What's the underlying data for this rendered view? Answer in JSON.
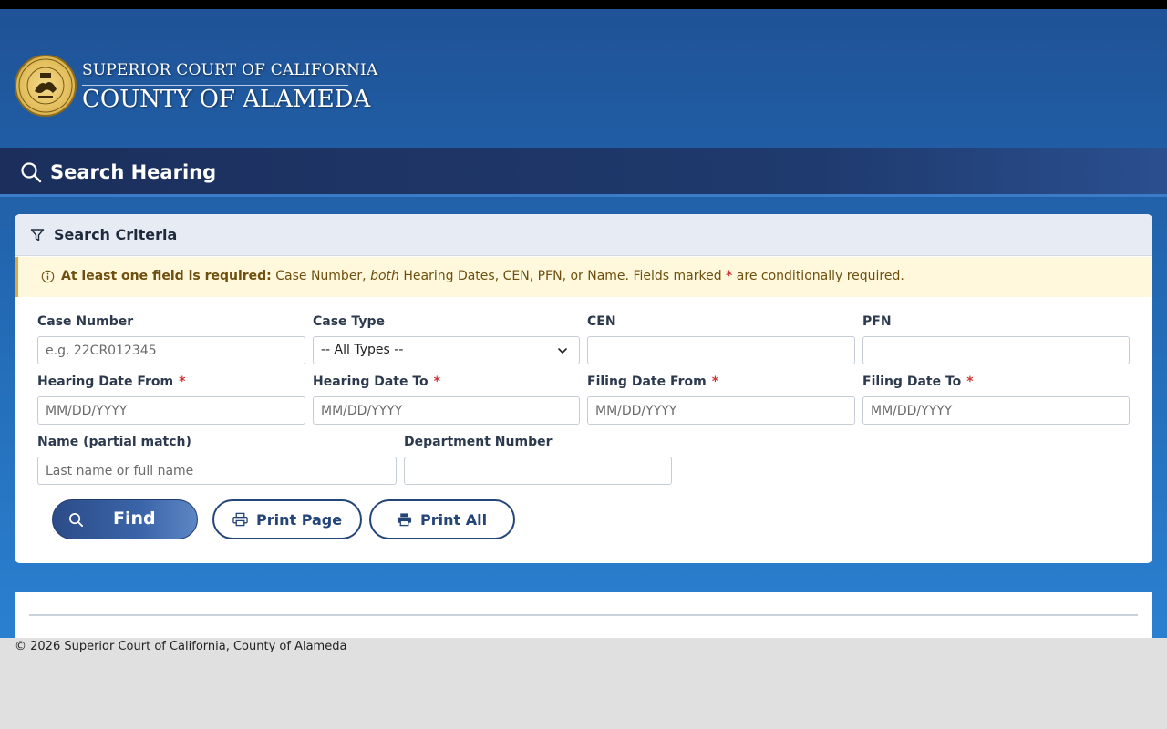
{
  "header": {
    "court_line1": "SUPERIOR COURT OF CALIFORNIA",
    "court_line2": "COUNTY OF ALAMEDA"
  },
  "page": {
    "title": "Search Hearing",
    "title_icon": "search-icon"
  },
  "criteria": {
    "heading": "Search Criteria",
    "heading_icon": "filter-icon",
    "notice": {
      "icon": "info-icon",
      "bold": "At least one field is required:",
      "part1": " Case Number, ",
      "italic": "both",
      "part2": " Hearing Dates, CEN, PFN, or Name. Fields marked ",
      "asterisk": "*",
      "part3": " are conditionally required."
    },
    "fields": {
      "case_number": {
        "label": "Case Number",
        "placeholder": "e.g. 22CR012345",
        "value": ""
      },
      "case_type": {
        "label": "Case Type",
        "selected": "-- All Types --"
      },
      "cen": {
        "label": "CEN",
        "value": ""
      },
      "pfn": {
        "label": "PFN",
        "value": ""
      },
      "hearing_from": {
        "label": "Hearing Date From",
        "placeholder": "MM/DD/YYYY",
        "required_mark": "*"
      },
      "hearing_to": {
        "label": "Hearing Date To",
        "placeholder": "MM/DD/YYYY",
        "required_mark": "*"
      },
      "filing_from": {
        "label": "Filing Date From",
        "placeholder": "MM/DD/YYYY",
        "required_mark": "*"
      },
      "filing_to": {
        "label": "Filing Date To",
        "placeholder": "MM/DD/YYYY",
        "required_mark": "*"
      },
      "name": {
        "label": "Name (partial match)",
        "placeholder": "Last name or full name"
      },
      "department": {
        "label": "Department Number",
        "value": ""
      }
    },
    "buttons": {
      "find": "Find",
      "print_page": "Print Page",
      "print_all": "Print All"
    }
  },
  "footer": {
    "copyright": "© 2026 Superior Court of California, County of Alameda"
  },
  "colors": {
    "brand_blue": "#1f5296",
    "title_bar": "#1c2f5c",
    "notice_bg": "#fff8dc",
    "notice_border": "#e3a93a",
    "required": "#cc3333",
    "button_blue": "#244577"
  }
}
